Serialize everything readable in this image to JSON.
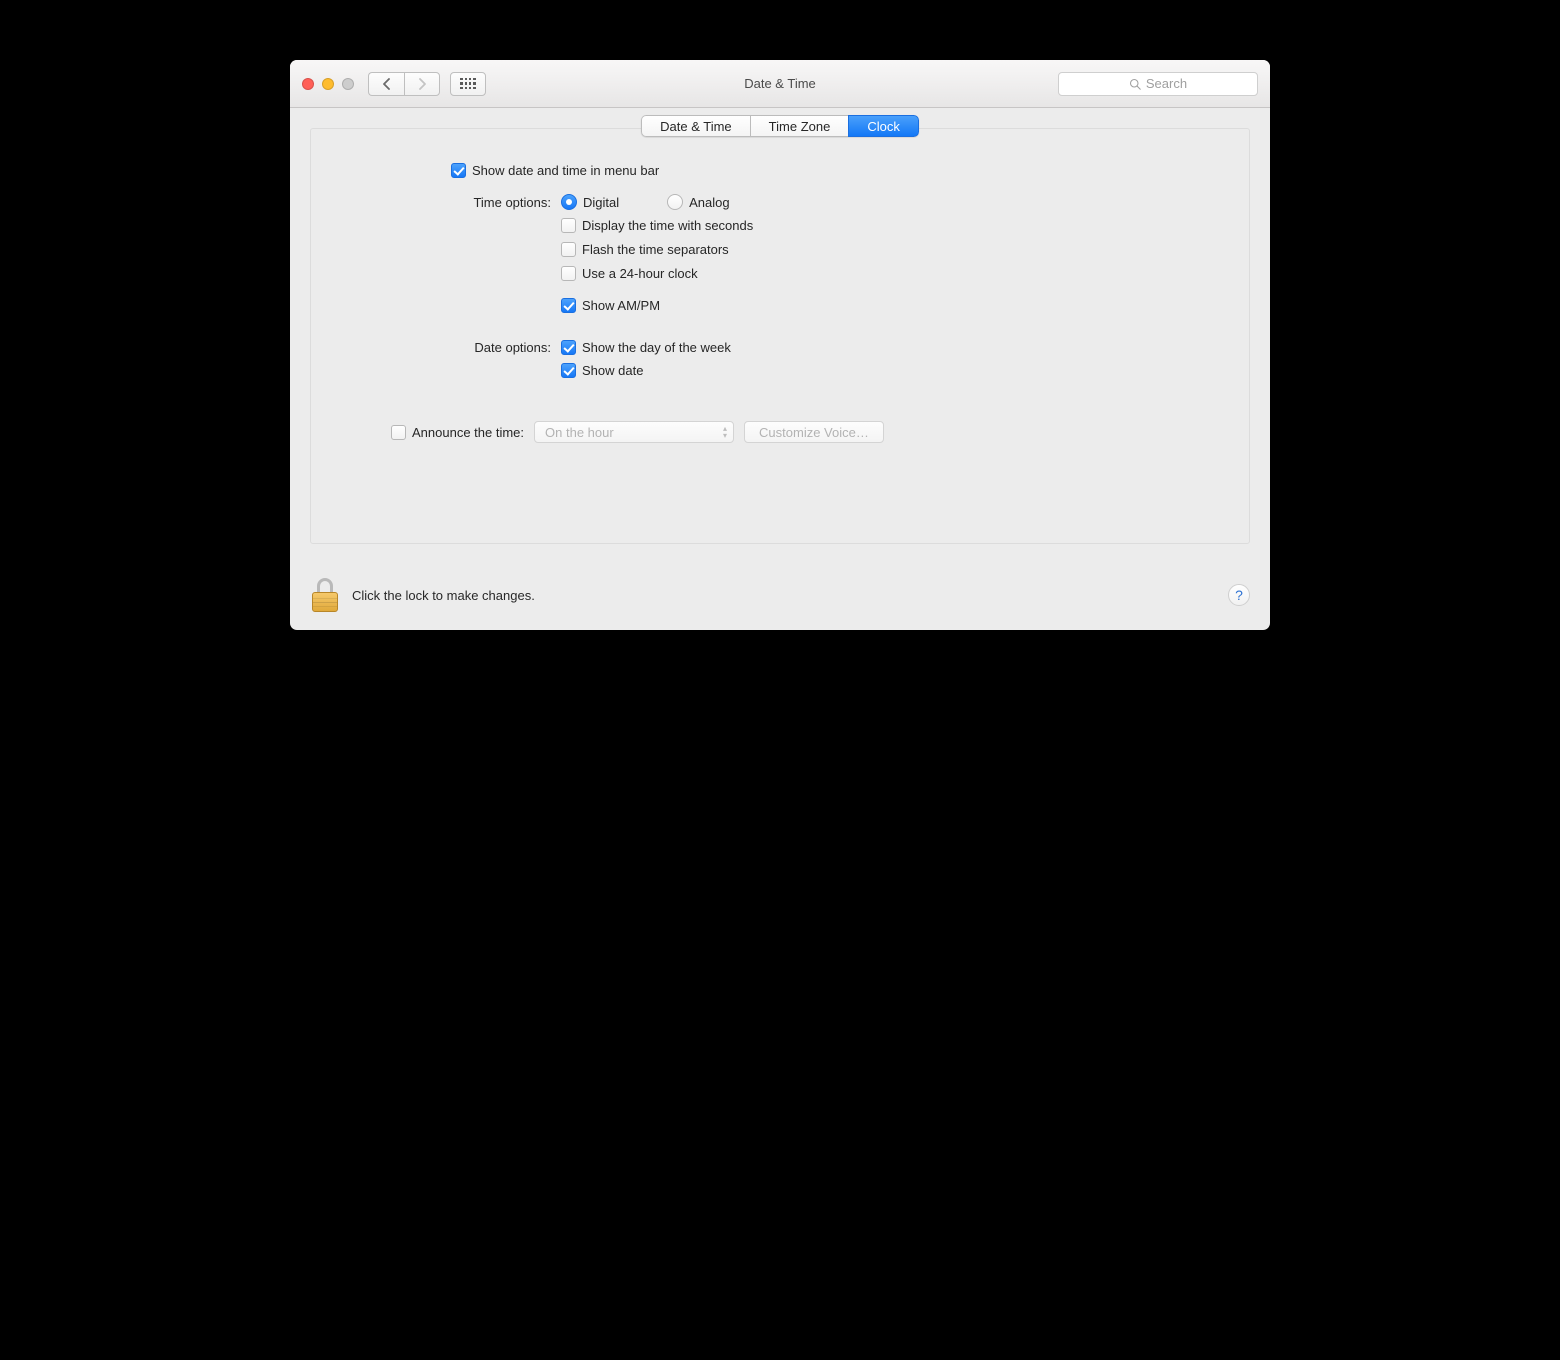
{
  "titlebar": {
    "window_title": "Date & Time",
    "search_placeholder": "Search"
  },
  "tabs": {
    "date_time": "Date & Time",
    "time_zone": "Time Zone",
    "clock": "Clock",
    "active": "clock"
  },
  "settings": {
    "show_in_menu_bar": {
      "label": "Show date and time in menu bar",
      "checked": true
    },
    "time_options_label": "Time options:",
    "time_mode": {
      "digital": {
        "label": "Digital",
        "selected": true
      },
      "analog": {
        "label": "Analog",
        "selected": false
      }
    },
    "display_seconds": {
      "label": "Display the time with seconds",
      "checked": false
    },
    "flash_separators": {
      "label": "Flash the time separators",
      "checked": false
    },
    "use_24_hour": {
      "label": "Use a 24-hour clock",
      "checked": false
    },
    "show_ampm": {
      "label": "Show AM/PM",
      "checked": true
    },
    "date_options_label": "Date options:",
    "show_day_of_week": {
      "label": "Show the day of the week",
      "checked": true
    },
    "show_date": {
      "label": "Show date",
      "checked": true
    },
    "announce": {
      "label": "Announce the time:",
      "checked": false,
      "interval": "On the hour",
      "customize_label": "Customize Voice…"
    }
  },
  "footer": {
    "lock_text": "Click the lock to make changes.",
    "help": "?"
  }
}
